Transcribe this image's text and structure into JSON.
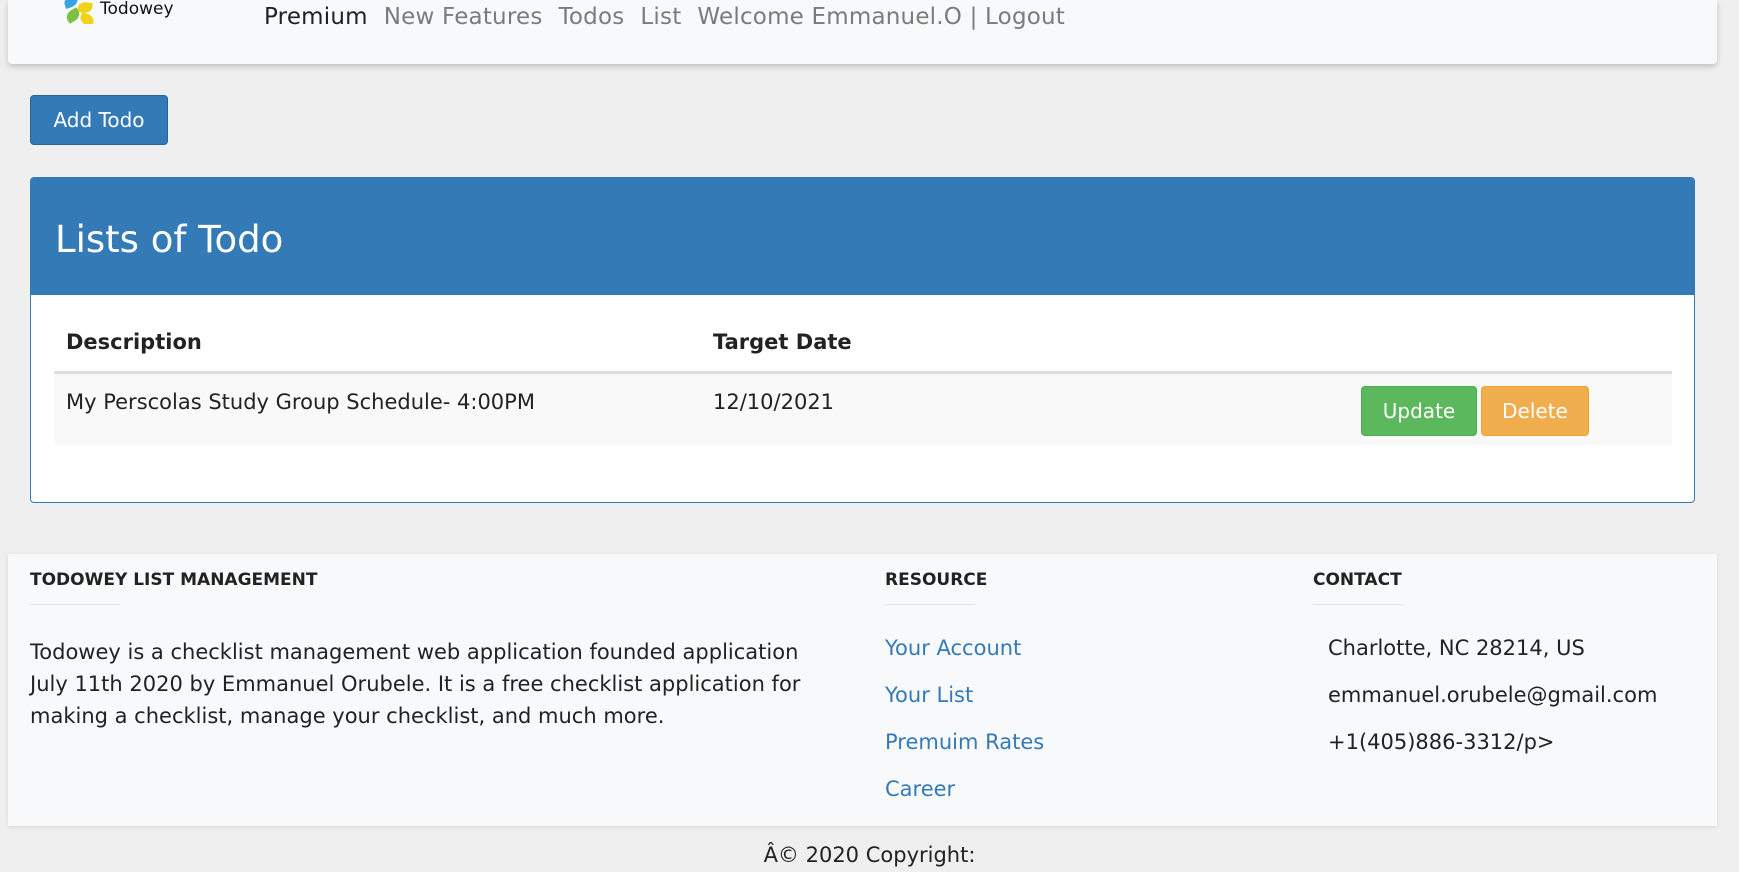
{
  "navbar": {
    "brand": "Todowey",
    "links": [
      {
        "label": "Premium",
        "active": true
      },
      {
        "label": "New Features",
        "active": false
      },
      {
        "label": "Todos",
        "active": false
      },
      {
        "label": "List",
        "active": false
      },
      {
        "label": "Welcome Emmanuel.O | Logout",
        "active": false
      }
    ]
  },
  "add_button_label": "Add Todo",
  "panel": {
    "title": "Lists of Todo",
    "columns": [
      "Description",
      "Target Date"
    ],
    "rows": [
      {
        "description": "My Perscolas Study Group Schedule- 4:00PM",
        "target_date": "12/10/2021"
      }
    ],
    "update_label": "Update",
    "delete_label": "Delete"
  },
  "footer": {
    "about_title": "TODOWEY LIST MANAGEMENT",
    "about_text": "Todowey is a checklist management web application founded application July 11th 2020 by Emmanuel Orubele. It is a free checklist application for making a checklist, manage your checklist, and much more.",
    "resource_title": "RESOURCE",
    "resource_links": [
      "Your Account",
      "Your List",
      "Premuim Rates",
      "Career"
    ],
    "contact_title": "CONTACT",
    "contact_items": [
      "Charlotte, NC 28214, US",
      "emmanuel.orubele@gmail.com",
      "+1(405)886-3312/p>"
    ]
  },
  "copyright": "Â© 2020 Copyright:",
  "colors": {
    "primary": "#337ab7",
    "success": "#5cb85c",
    "warning": "#f0ad4e",
    "background": "#efefef",
    "surface": "#f8f9fa"
  }
}
